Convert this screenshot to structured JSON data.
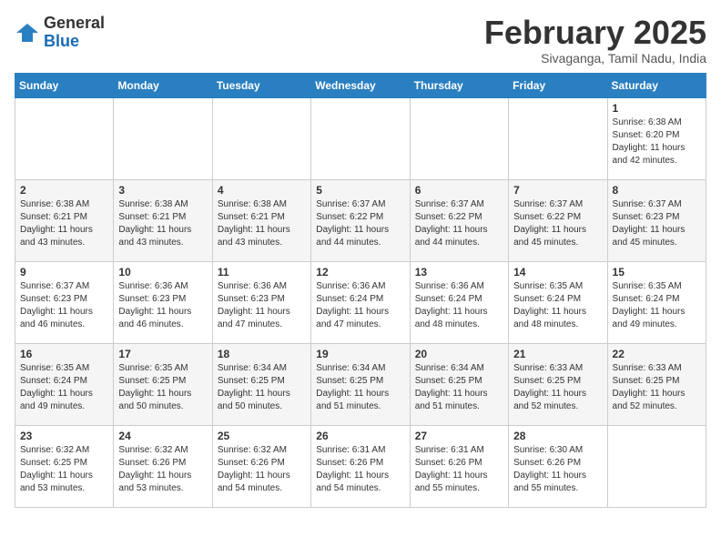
{
  "header": {
    "logo_general": "General",
    "logo_blue": "Blue",
    "month": "February 2025",
    "location": "Sivaganga, Tamil Nadu, India"
  },
  "days_of_week": [
    "Sunday",
    "Monday",
    "Tuesday",
    "Wednesday",
    "Thursday",
    "Friday",
    "Saturday"
  ],
  "weeks": [
    [
      {
        "day": "",
        "info": ""
      },
      {
        "day": "",
        "info": ""
      },
      {
        "day": "",
        "info": ""
      },
      {
        "day": "",
        "info": ""
      },
      {
        "day": "",
        "info": ""
      },
      {
        "day": "",
        "info": ""
      },
      {
        "day": "1",
        "info": "Sunrise: 6:38 AM\nSunset: 6:20 PM\nDaylight: 11 hours and 42 minutes."
      }
    ],
    [
      {
        "day": "2",
        "info": "Sunrise: 6:38 AM\nSunset: 6:21 PM\nDaylight: 11 hours and 43 minutes."
      },
      {
        "day": "3",
        "info": "Sunrise: 6:38 AM\nSunset: 6:21 PM\nDaylight: 11 hours and 43 minutes."
      },
      {
        "day": "4",
        "info": "Sunrise: 6:38 AM\nSunset: 6:21 PM\nDaylight: 11 hours and 43 minutes."
      },
      {
        "day": "5",
        "info": "Sunrise: 6:37 AM\nSunset: 6:22 PM\nDaylight: 11 hours and 44 minutes."
      },
      {
        "day": "6",
        "info": "Sunrise: 6:37 AM\nSunset: 6:22 PM\nDaylight: 11 hours and 44 minutes."
      },
      {
        "day": "7",
        "info": "Sunrise: 6:37 AM\nSunset: 6:22 PM\nDaylight: 11 hours and 45 minutes."
      },
      {
        "day": "8",
        "info": "Sunrise: 6:37 AM\nSunset: 6:23 PM\nDaylight: 11 hours and 45 minutes."
      }
    ],
    [
      {
        "day": "9",
        "info": "Sunrise: 6:37 AM\nSunset: 6:23 PM\nDaylight: 11 hours and 46 minutes."
      },
      {
        "day": "10",
        "info": "Sunrise: 6:36 AM\nSunset: 6:23 PM\nDaylight: 11 hours and 46 minutes."
      },
      {
        "day": "11",
        "info": "Sunrise: 6:36 AM\nSunset: 6:23 PM\nDaylight: 11 hours and 47 minutes."
      },
      {
        "day": "12",
        "info": "Sunrise: 6:36 AM\nSunset: 6:24 PM\nDaylight: 11 hours and 47 minutes."
      },
      {
        "day": "13",
        "info": "Sunrise: 6:36 AM\nSunset: 6:24 PM\nDaylight: 11 hours and 48 minutes."
      },
      {
        "day": "14",
        "info": "Sunrise: 6:35 AM\nSunset: 6:24 PM\nDaylight: 11 hours and 48 minutes."
      },
      {
        "day": "15",
        "info": "Sunrise: 6:35 AM\nSunset: 6:24 PM\nDaylight: 11 hours and 49 minutes."
      }
    ],
    [
      {
        "day": "16",
        "info": "Sunrise: 6:35 AM\nSunset: 6:24 PM\nDaylight: 11 hours and 49 minutes."
      },
      {
        "day": "17",
        "info": "Sunrise: 6:35 AM\nSunset: 6:25 PM\nDaylight: 11 hours and 50 minutes."
      },
      {
        "day": "18",
        "info": "Sunrise: 6:34 AM\nSunset: 6:25 PM\nDaylight: 11 hours and 50 minutes."
      },
      {
        "day": "19",
        "info": "Sunrise: 6:34 AM\nSunset: 6:25 PM\nDaylight: 11 hours and 51 minutes."
      },
      {
        "day": "20",
        "info": "Sunrise: 6:34 AM\nSunset: 6:25 PM\nDaylight: 11 hours and 51 minutes."
      },
      {
        "day": "21",
        "info": "Sunrise: 6:33 AM\nSunset: 6:25 PM\nDaylight: 11 hours and 52 minutes."
      },
      {
        "day": "22",
        "info": "Sunrise: 6:33 AM\nSunset: 6:25 PM\nDaylight: 11 hours and 52 minutes."
      }
    ],
    [
      {
        "day": "23",
        "info": "Sunrise: 6:32 AM\nSunset: 6:25 PM\nDaylight: 11 hours and 53 minutes."
      },
      {
        "day": "24",
        "info": "Sunrise: 6:32 AM\nSunset: 6:26 PM\nDaylight: 11 hours and 53 minutes."
      },
      {
        "day": "25",
        "info": "Sunrise: 6:32 AM\nSunset: 6:26 PM\nDaylight: 11 hours and 54 minutes."
      },
      {
        "day": "26",
        "info": "Sunrise: 6:31 AM\nSunset: 6:26 PM\nDaylight: 11 hours and 54 minutes."
      },
      {
        "day": "27",
        "info": "Sunrise: 6:31 AM\nSunset: 6:26 PM\nDaylight: 11 hours and 55 minutes."
      },
      {
        "day": "28",
        "info": "Sunrise: 6:30 AM\nSunset: 6:26 PM\nDaylight: 11 hours and 55 minutes."
      },
      {
        "day": "",
        "info": ""
      }
    ]
  ]
}
